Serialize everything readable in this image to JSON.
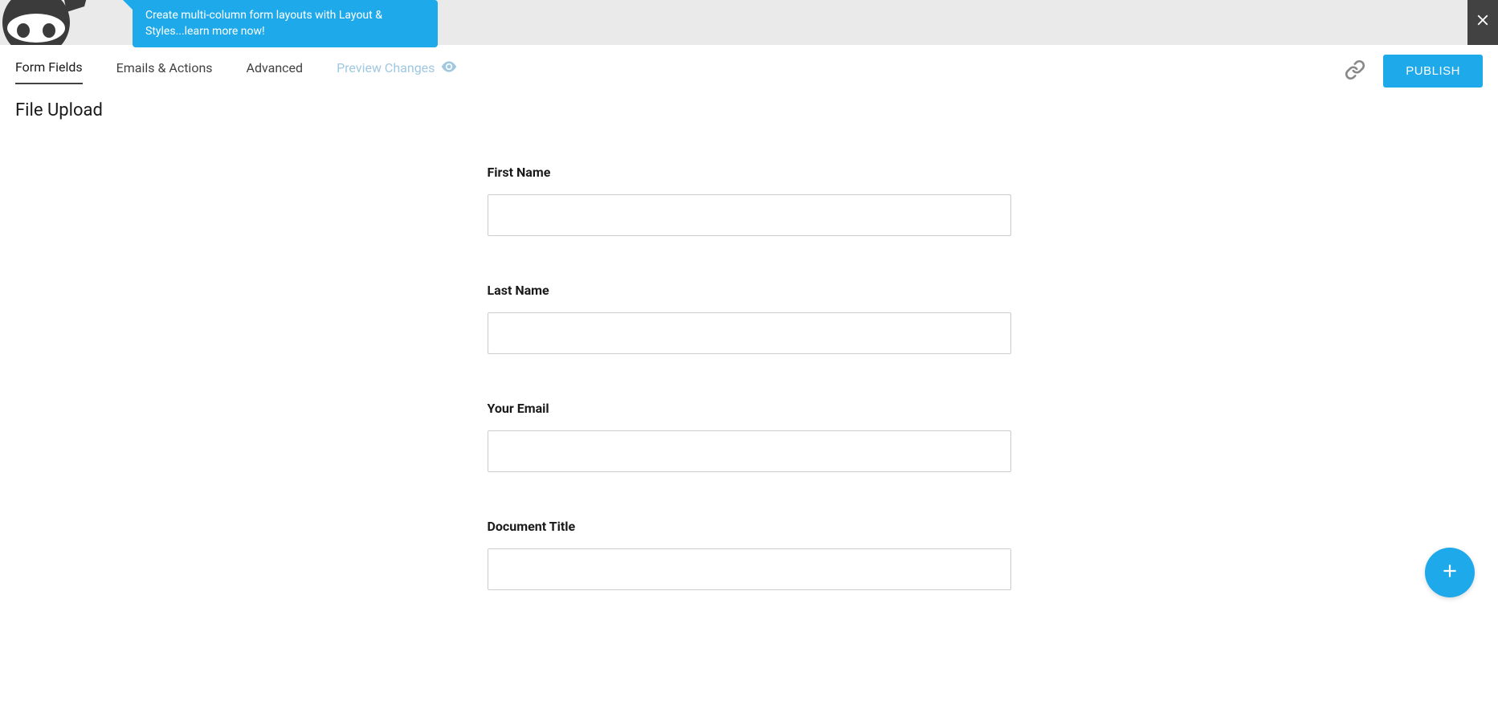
{
  "banner": {
    "promo_text": "Create multi-column form layouts with Layout & Styles...learn more now!"
  },
  "tabs": {
    "form_fields": "Form Fields",
    "emails_actions": "Emails & Actions",
    "advanced": "Advanced",
    "preview_changes": "Preview Changes"
  },
  "actions": {
    "publish": "PUBLISH"
  },
  "page": {
    "title": "File Upload"
  },
  "form": {
    "fields": [
      {
        "label": "First Name"
      },
      {
        "label": "Last Name"
      },
      {
        "label": "Your Email"
      },
      {
        "label": "Document Title"
      }
    ]
  }
}
